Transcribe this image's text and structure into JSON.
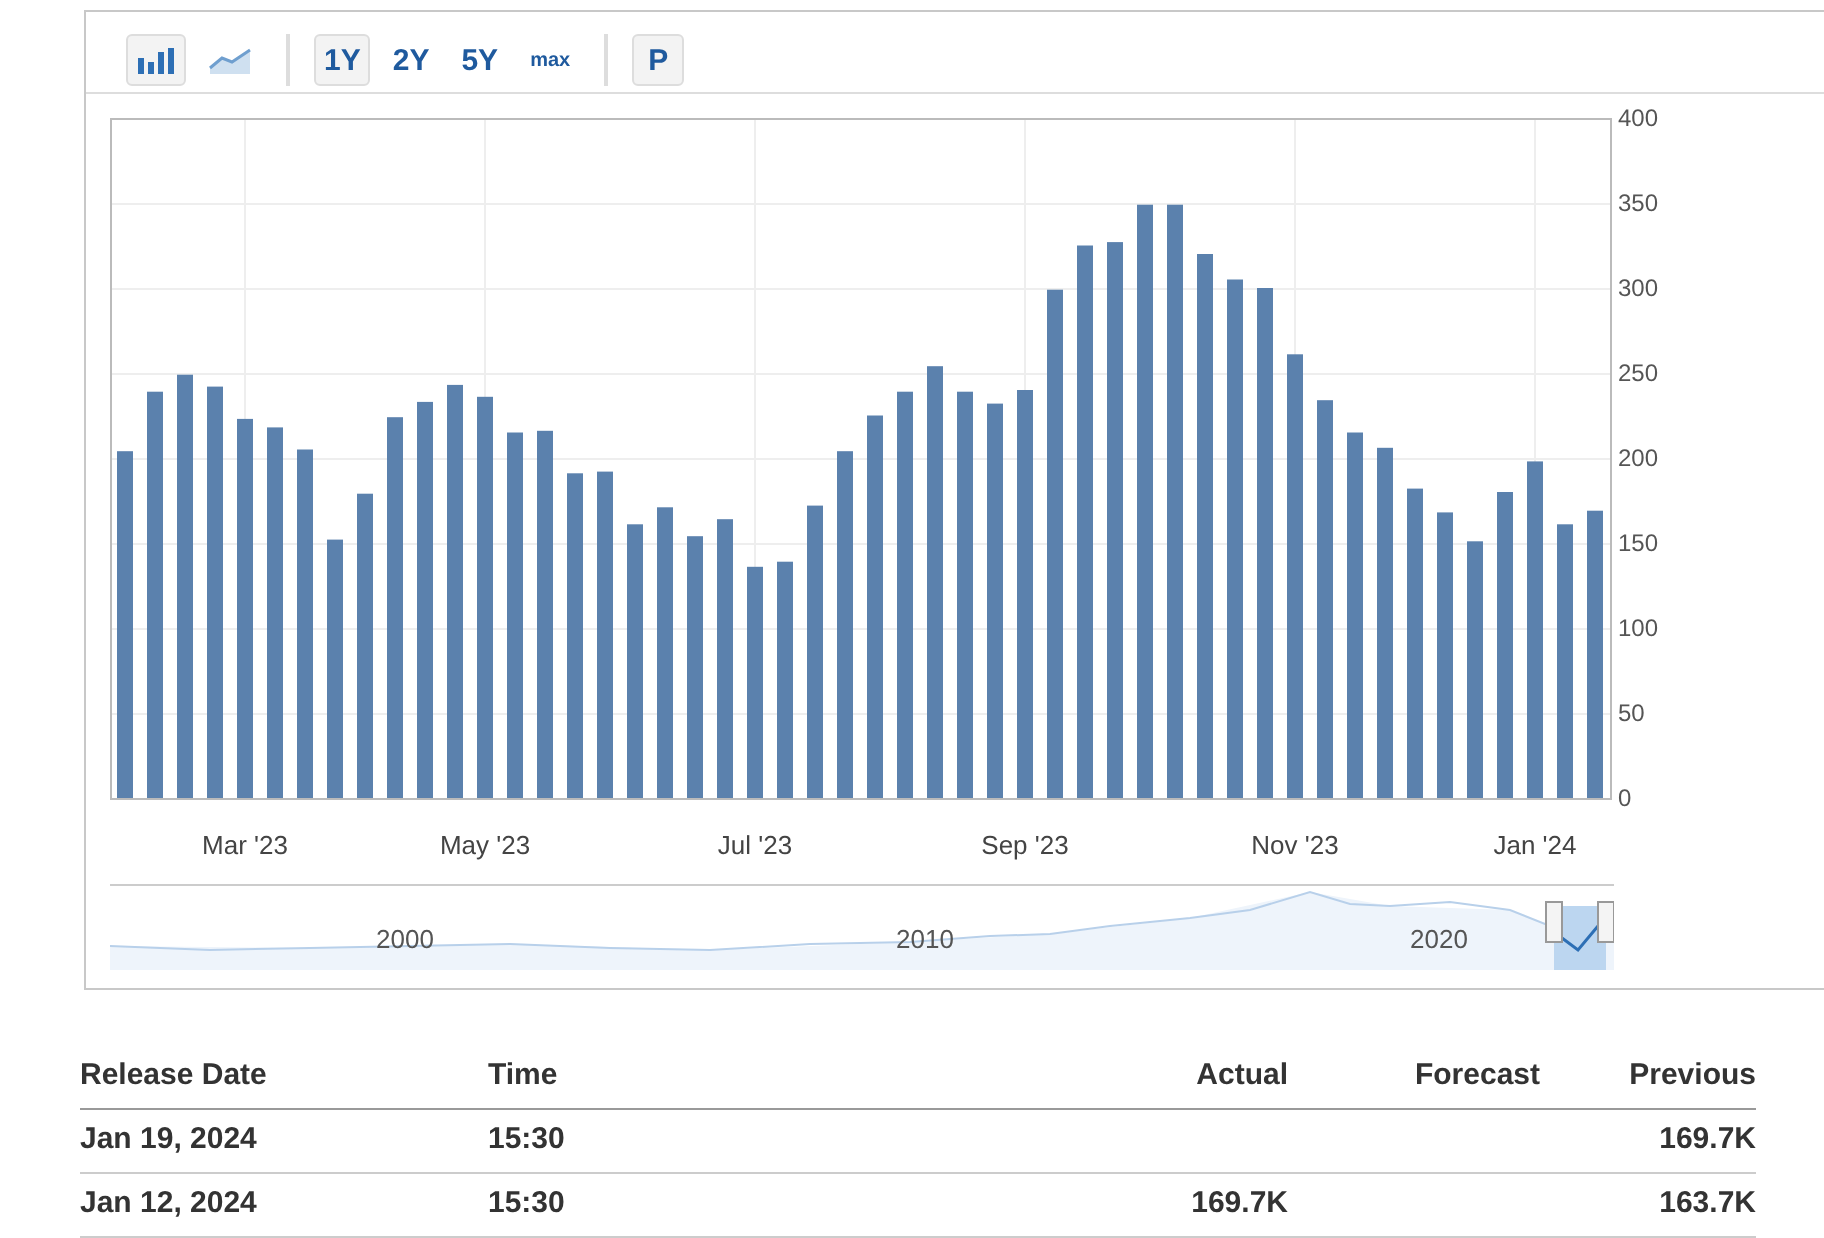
{
  "toolbar": {
    "chart_types": [
      {
        "kind": "bar",
        "selected": true
      },
      {
        "kind": "area",
        "selected": false
      }
    ],
    "ranges": [
      {
        "label": "1Y",
        "selected": true
      },
      {
        "label": "2Y",
        "selected": false
      },
      {
        "label": "5Y",
        "selected": false
      },
      {
        "label": "max",
        "selected": false
      }
    ],
    "extra_button": {
      "label": "P",
      "selected": false
    }
  },
  "chart": {
    "chart_data": {
      "type": "bar",
      "categories": [
        null,
        null,
        null,
        null,
        "Mar '23",
        null,
        null,
        null,
        null,
        null,
        null,
        null,
        "May '23",
        null,
        null,
        null,
        null,
        null,
        null,
        null,
        null,
        "Jul '23",
        null,
        null,
        null,
        null,
        null,
        null,
        null,
        null,
        "Sep '23",
        null,
        null,
        null,
        null,
        null,
        null,
        null,
        null,
        "Nov '23",
        null,
        null,
        null,
        null,
        null,
        null,
        null,
        "Jan '24",
        null,
        null
      ],
      "series": [
        {
          "color": "#5b81ad",
          "values": [
            204,
            239,
            249,
            242,
            223,
            218,
            205,
            152,
            179,
            224,
            233,
            243,
            236,
            215,
            216,
            191,
            192,
            161,
            171,
            154,
            164,
            136,
            139,
            172,
            204,
            225,
            239,
            254,
            239,
            232,
            240,
            299,
            325,
            327,
            349,
            349,
            320,
            305,
            300,
            261,
            234,
            215,
            206,
            182,
            168,
            151,
            180,
            198,
            161,
            169
          ]
        }
      ],
      "grid": true,
      "ylim": [
        0,
        400
      ],
      "yticks": [
        0,
        50,
        100,
        150,
        200,
        250,
        300,
        350,
        400
      ]
    }
  },
  "navigator": {
    "labels": [
      "2000",
      "2010",
      "2020"
    ]
  },
  "table": {
    "columns": [
      "Release Date",
      "Time",
      "Actual",
      "Forecast",
      "Previous"
    ],
    "rows": [
      [
        "Jan 19, 2024",
        "15:30",
        "",
        "",
        "169.7K"
      ],
      [
        "Jan 12, 2024",
        "15:30",
        "169.7K",
        "",
        "163.7K"
      ]
    ]
  }
}
